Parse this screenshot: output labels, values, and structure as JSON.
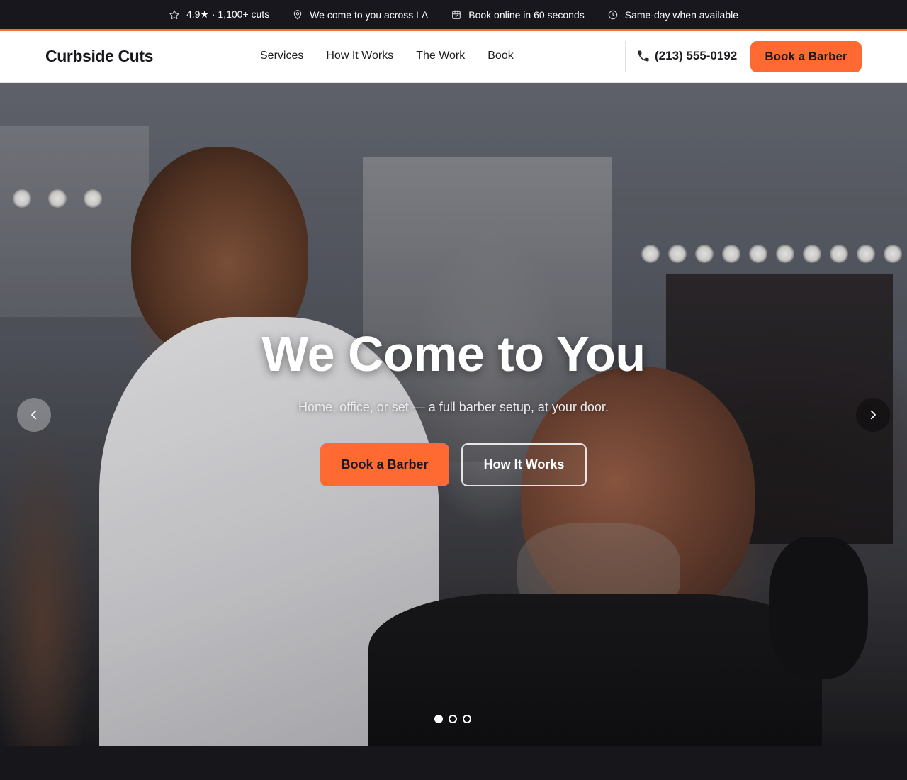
{
  "topbar": {
    "items": [
      {
        "icon": "star-icon",
        "text": "4.9★ · 1,100+ cuts"
      },
      {
        "icon": "map-pin-icon",
        "text": "We come to you across LA"
      },
      {
        "icon": "calendar-icon",
        "text": "Book online in 60 seconds"
      },
      {
        "icon": "clock-icon",
        "text": "Same-day when available"
      }
    ]
  },
  "header": {
    "logo": "Curbside Cuts",
    "nav": [
      "Services",
      "How It Works",
      "The Work",
      "Book"
    ],
    "phone": "(213) 555-0192",
    "cta": "Book a Barber"
  },
  "hero": {
    "title": "We Come to You",
    "subtitle": "Home, office, or set — a full barber setup, at your door.",
    "primary_cta": "Book a Barber",
    "secondary_cta": "How It Works",
    "slides_total": 3,
    "active_slide": 1
  },
  "colors": {
    "accent": "#ff6a33",
    "dark": "#17171d",
    "white": "#ffffff"
  }
}
